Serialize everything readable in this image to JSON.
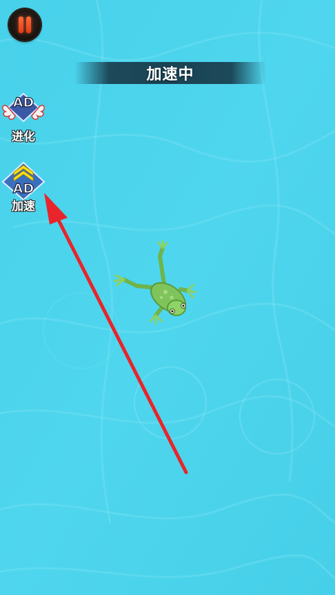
{
  "hud": {
    "status_banner": "加速中"
  },
  "side_buttons": [
    {
      "ad_badge": "AD",
      "label": "进化"
    },
    {
      "ad_badge": "AD",
      "label": "加速"
    }
  ],
  "colors": {
    "water": "#4fd5ec",
    "arrow": "#e8252a",
    "pause_accent": "#e53c12",
    "frog": "#7fc45a"
  },
  "icons": {
    "pause": "pause-icon",
    "evolve": "wings-icon",
    "speed": "chevrons-up-icon"
  }
}
